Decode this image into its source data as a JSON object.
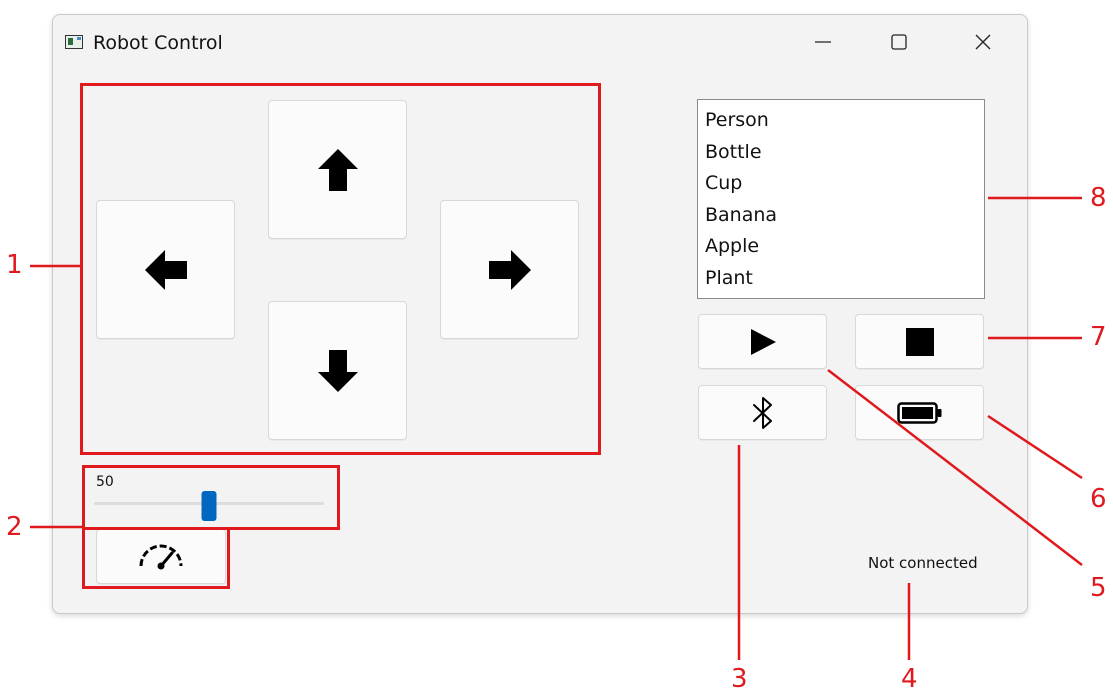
{
  "window": {
    "title": "Robot Control",
    "controls": [
      "minimize-icon",
      "maximize-icon",
      "close-icon"
    ]
  },
  "direction_pad": {
    "up_icon": "arrow-up-icon",
    "left_icon": "arrow-left-icon",
    "right_icon": "arrow-right-icon",
    "down_icon": "arrow-down-icon"
  },
  "object_list": {
    "items": [
      "Person",
      "Bottle",
      "Cup",
      "Banana",
      "Apple",
      "Plant"
    ]
  },
  "buttons": {
    "play_icon": "play-icon",
    "stop_icon": "stop-icon",
    "bluetooth_icon": "bluetooth-icon",
    "battery_icon": "battery-icon",
    "speed_icon": "speedometer-icon"
  },
  "speed_slider": {
    "value_label": "50",
    "value": 50,
    "min": 0,
    "max": 100,
    "accent": "#0067c0"
  },
  "status": {
    "text": "Not connected"
  },
  "callouts": {
    "labels": [
      "1",
      "2",
      "3",
      "4",
      "5",
      "6",
      "7",
      "8"
    ],
    "color": "#e0191e"
  }
}
